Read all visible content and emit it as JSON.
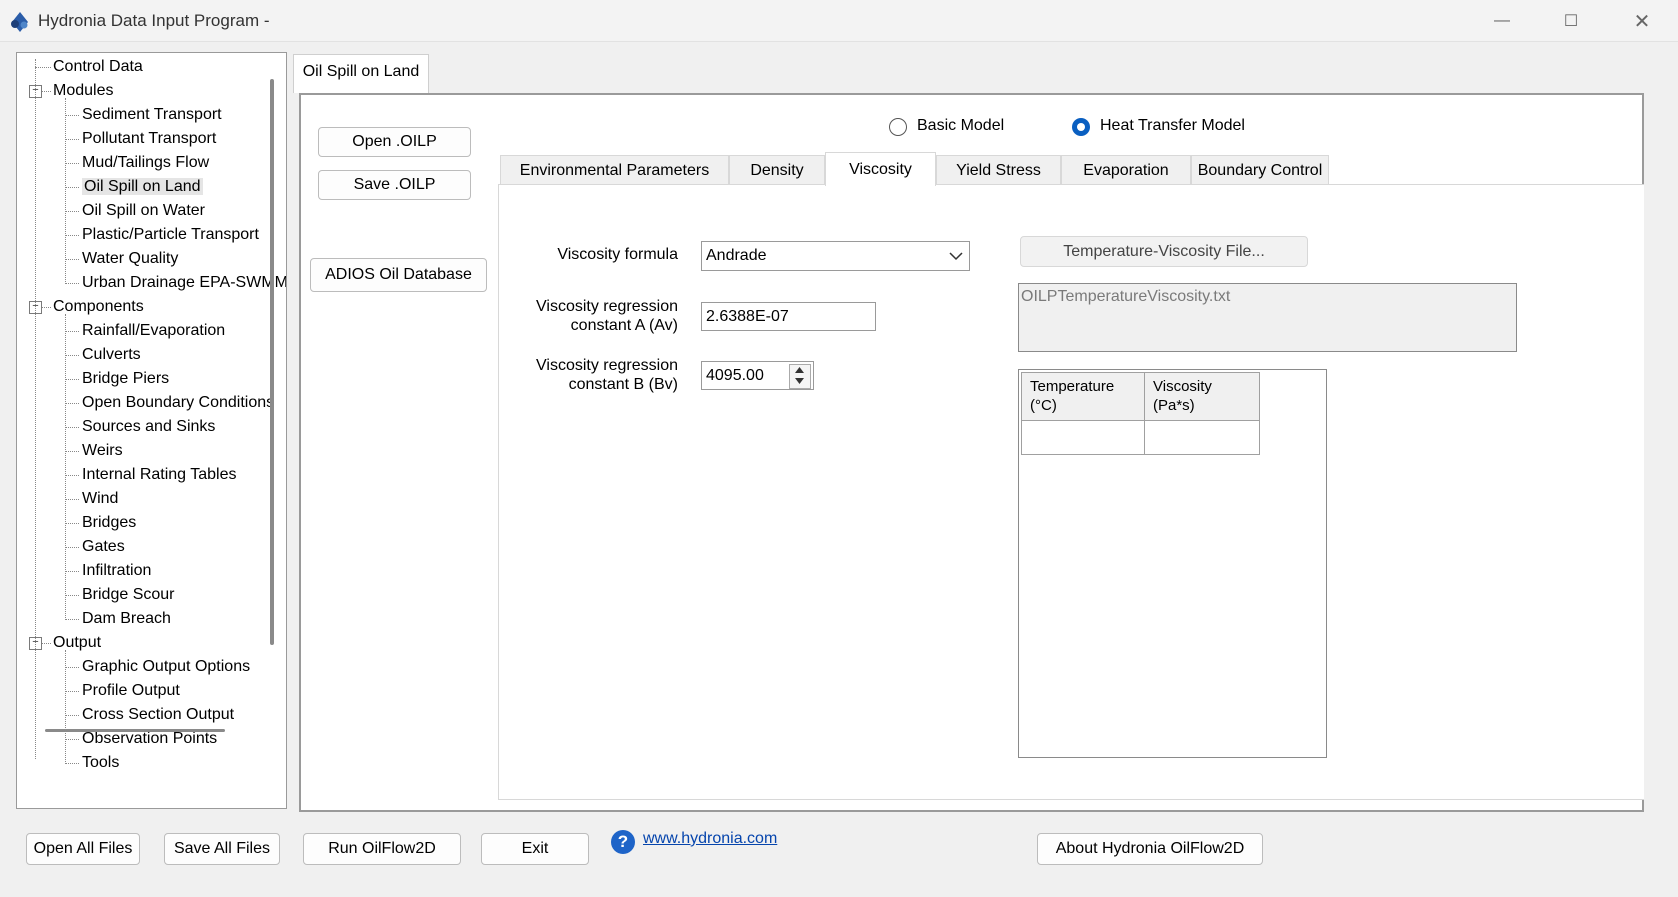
{
  "window": {
    "title": "Hydronia Data Input Program -",
    "minimize_glyph": "—",
    "maximize_glyph": "☐",
    "close_glyph": "✕"
  },
  "tree": {
    "items": [
      {
        "label": "Control Data",
        "level": 0,
        "expander": ""
      },
      {
        "label": "Modules",
        "level": 0,
        "expander": "−"
      },
      {
        "label": "Sediment Transport",
        "level": 1
      },
      {
        "label": "Pollutant Transport",
        "level": 1
      },
      {
        "label": "Mud/Tailings Flow",
        "level": 1
      },
      {
        "label": "Oil Spill on Land",
        "level": 1,
        "selected": true
      },
      {
        "label": "Oil Spill on Water",
        "level": 1
      },
      {
        "label": "Plastic/Particle Transport",
        "level": 1
      },
      {
        "label": "Water Quality",
        "level": 1
      },
      {
        "label": "Urban Drainage EPA-SWMM",
        "level": 1
      },
      {
        "label": "Components",
        "level": 0,
        "expander": "−"
      },
      {
        "label": "Rainfall/Evaporation",
        "level": 1
      },
      {
        "label": "Culverts",
        "level": 1
      },
      {
        "label": "Bridge Piers",
        "level": 1
      },
      {
        "label": "Open Boundary Conditions",
        "level": 1
      },
      {
        "label": "Sources and Sinks",
        "level": 1
      },
      {
        "label": "Weirs",
        "level": 1
      },
      {
        "label": "Internal Rating Tables",
        "level": 1
      },
      {
        "label": "Wind",
        "level": 1
      },
      {
        "label": "Bridges",
        "level": 1
      },
      {
        "label": "Gates",
        "level": 1
      },
      {
        "label": "Infiltration",
        "level": 1
      },
      {
        "label": "Bridge Scour",
        "level": 1
      },
      {
        "label": "Dam Breach",
        "level": 1
      },
      {
        "label": "Output",
        "level": 0,
        "expander": "−"
      },
      {
        "label": "Graphic Output Options",
        "level": 1
      },
      {
        "label": "Profile Output",
        "level": 1
      },
      {
        "label": "Cross Section Output",
        "level": 1
      },
      {
        "label": "Observation Points",
        "level": 1
      },
      {
        "label": "Tools",
        "level": 1
      }
    ]
  },
  "outer_tab": {
    "label": "Oil Spill on Land"
  },
  "side_buttons": {
    "open": "Open .OILP",
    "save": "Save .OILP",
    "adios": "ADIOS Oil Database"
  },
  "model": {
    "basic_label": "Basic Model",
    "heat_label": "Heat Transfer Model",
    "selected": "Heat Transfer Model"
  },
  "tabs": [
    {
      "label": "Environmental Parameters"
    },
    {
      "label": "Density"
    },
    {
      "label": "Viscosity",
      "active": true
    },
    {
      "label": "Yield Stress"
    },
    {
      "label": "Evaporation"
    },
    {
      "label": "Boundary Control"
    }
  ],
  "viscosity": {
    "formula_label": "Viscosity formula",
    "formula_value": "Andrade",
    "a_label_line1": "Viscosity regression",
    "a_label_line2": "constant A (Av)",
    "a_value": "2.6388E-07",
    "b_label_line1": "Viscosity regression",
    "b_label_line2": "constant B (Bv)",
    "b_value": "4095.00",
    "file_button": "Temperature-Viscosity File...",
    "file_name": "OILPTemperatureViscosity.txt",
    "table_headers": [
      "Temperature (°C)",
      "Viscosity (Pa*s)"
    ]
  },
  "bottom": {
    "open_all": "Open All Files",
    "save_all": "Save All Files",
    "run": "Run OilFlow2D",
    "exit": "Exit",
    "help_glyph": "?",
    "link": "www.hydronia.com",
    "about": "About Hydronia OilFlow2D"
  },
  "colors": {
    "accent": "#0a5fc1",
    "link": "#0645ad",
    "window_bg": "#f0f0f0"
  }
}
